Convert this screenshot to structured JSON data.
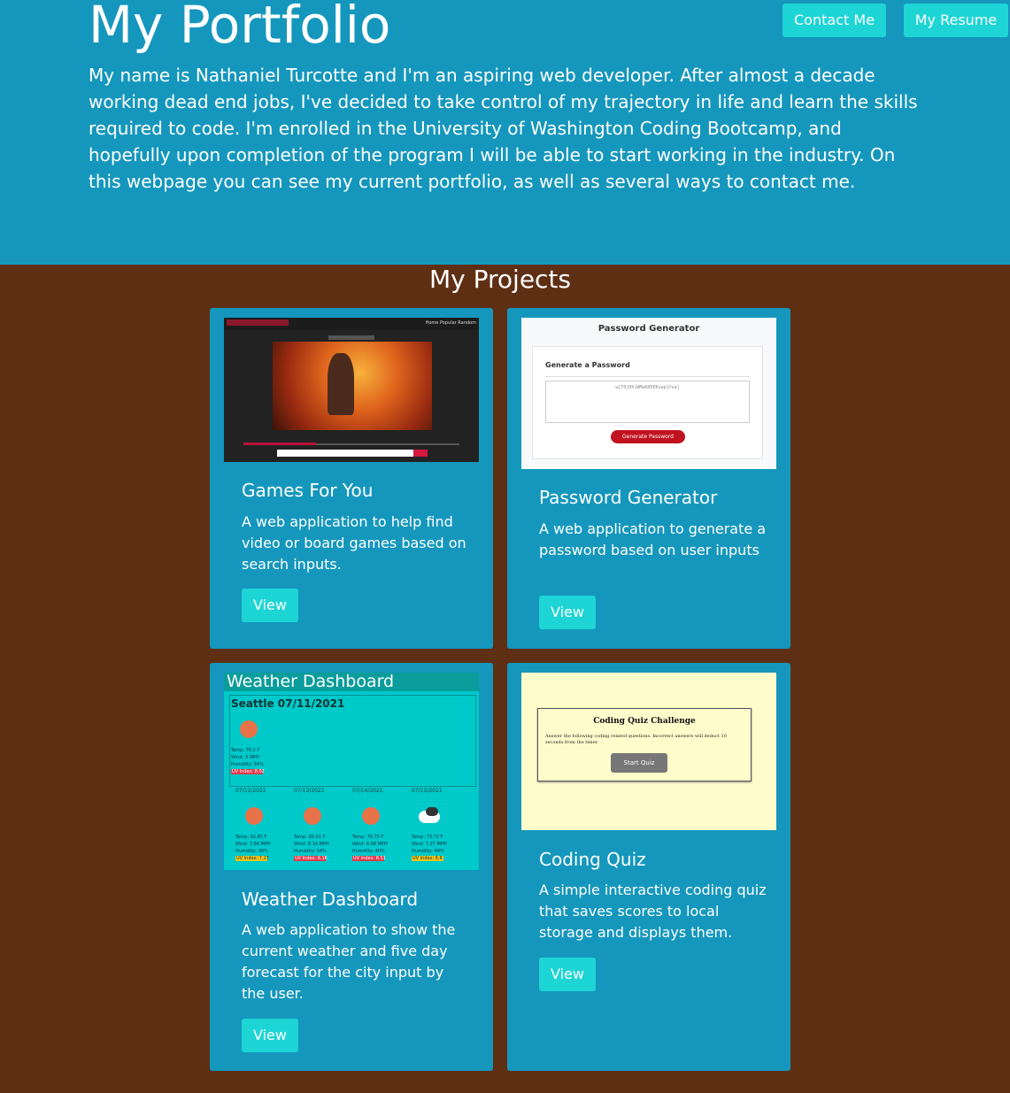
{
  "header": {
    "title": "My Portfolio",
    "intro": "My name is Nathaniel Turcotte and I'm an aspiring web developer. After almost a decade working dead end jobs, I've decided to take control of my trajectory in life and learn the skills required to code. I'm enrolled in the University of Washington Coding Bootcamp, and hopefully upon completion of the program I will be able to start working in the industry. On this webpage you can see my current portfolio, as well as several ways to contact me.",
    "contact_label": "Contact Me",
    "resume_label": "My Resume"
  },
  "colors": {
    "header_bg": "#1597bd",
    "page_bg": "#5f2f14",
    "button_bg": "#1dd5d5",
    "card_bg": "#1597bd"
  },
  "projects": {
    "heading": "My Projects",
    "items": [
      {
        "title": "Games For You",
        "description": "A web application to help find video or board games based on search inputs.",
        "button_label": "View"
      },
      {
        "title": "Password Generator",
        "description": "A web application to generate a password based on user inputs",
        "button_label": "View"
      },
      {
        "title": "Weather Dashboard",
        "description": "A web application to show the current weather and five day forecast for the city input by the user.",
        "button_label": "View"
      },
      {
        "title": "Coding Quiz",
        "description": "A simple interactive coding quiz that saves scores to local storage and displays them.",
        "button_label": "View"
      }
    ]
  },
  "thumbnails": {
    "games": {
      "nav": "Home  Popular  Random"
    },
    "password": {
      "title": "Password Generator",
      "subtitle": "Generate a Password",
      "generated": "w[T0]HXiWMa6H5ERswp1foa]",
      "button": "Generate Password"
    },
    "weather": {
      "title": "Weather Dashboard",
      "city_date": "Seattle 07/11/2021",
      "current_temp": "Temp: 76.1 F",
      "current_wind": "Wind: 3 MPH",
      "current_humidity": "Humidity: 54%",
      "current_uv": "UV Index: 8.02",
      "forecast": [
        {
          "date": "07/12/2021",
          "temp": "Temp: 82.85 F",
          "wind": "Wind: 7.94 MPH",
          "humidity": "Humidity: 38%",
          "uv": "UV Index: 7.27",
          "icon": "sun-icon"
        },
        {
          "date": "07/13/2021",
          "temp": "Temp: 85.01 F",
          "wind": "Wind: 8.14 MPH",
          "humidity": "Humidity: 34%",
          "uv": "UV Index: 8.16",
          "icon": "sun-icon"
        },
        {
          "date": "07/14/2021",
          "temp": "Temp: 79.75 F",
          "wind": "Wind: 6.68 MPH",
          "humidity": "Humidity: 40%",
          "uv": "UV Index: 8.51",
          "icon": "sun-icon"
        },
        {
          "date": "07/15/2021",
          "temp": "Temp: 73.72 F",
          "wind": "Wind: 7.27 MPH",
          "humidity": "Humidity: 49%",
          "uv": "UV Index: 6.8",
          "icon": "cloud-icon"
        }
      ]
    },
    "quiz": {
      "title": "Coding Quiz Challenge",
      "text": "Answer the following coding related questions. Incorrect answers will deduct 10 seconds from the timer.",
      "button": "Start Quiz"
    }
  }
}
